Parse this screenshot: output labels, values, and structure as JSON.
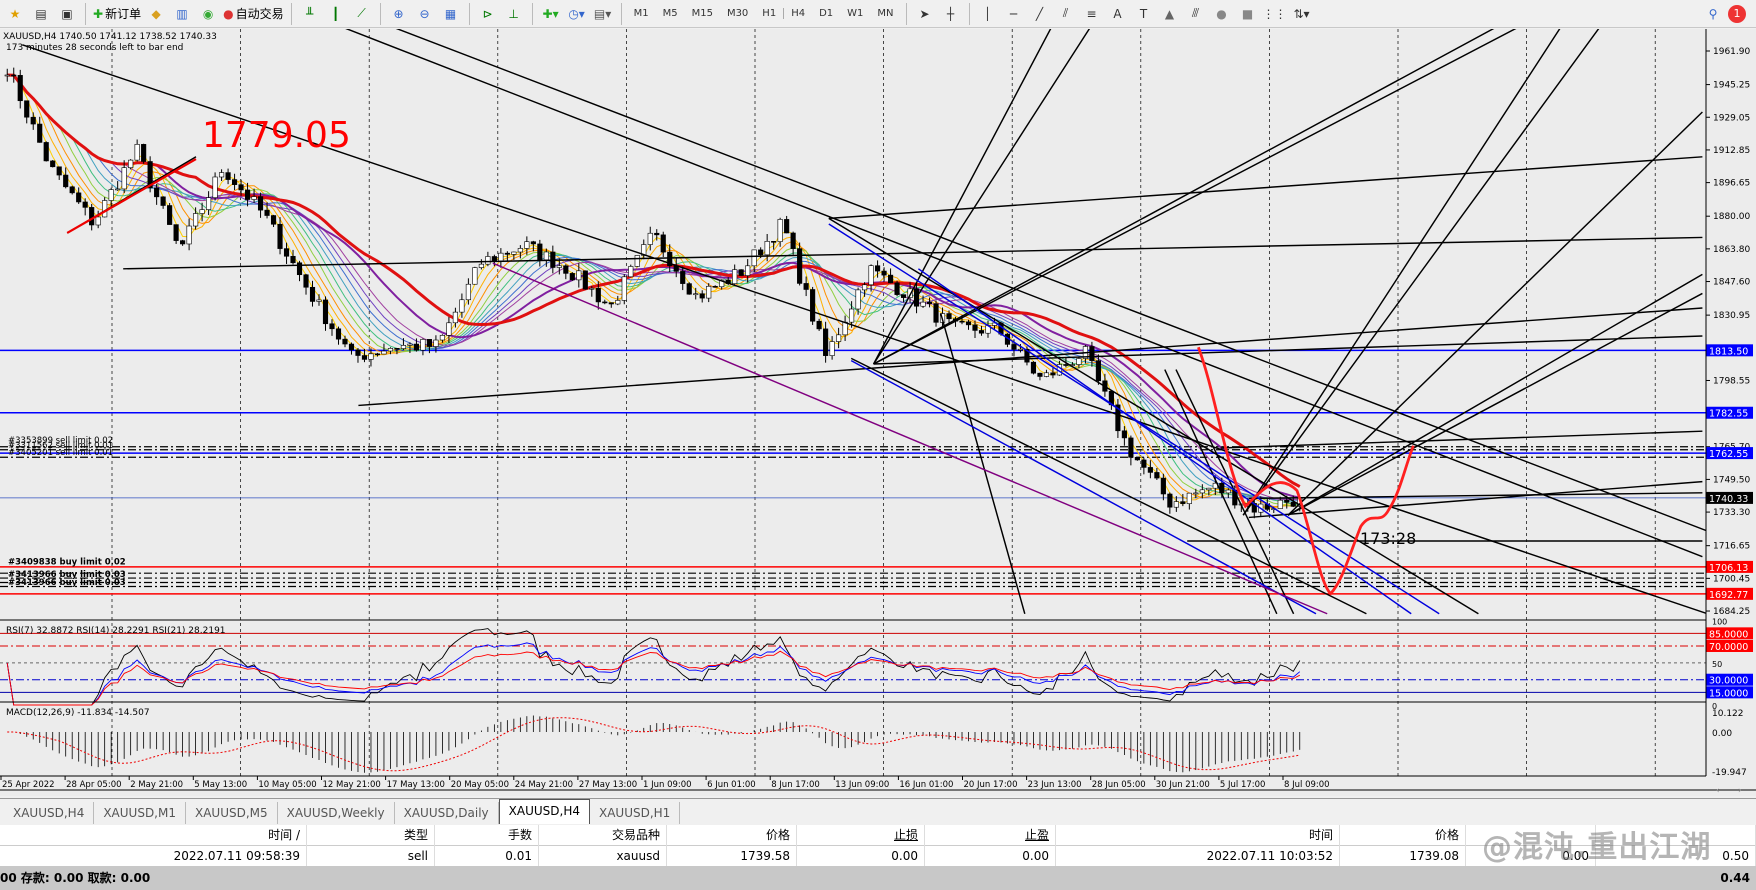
{
  "toolbar": {
    "new_order": "新订单",
    "auto_trading": "自动交易",
    "timeframes": [
      "M1",
      "M5",
      "M15",
      "M30",
      "H1",
      "H4",
      "D1",
      "W1",
      "MN"
    ],
    "notification_count": "1"
  },
  "chart": {
    "symbol_info": "XAUUSD,H4  1740.50 1741.12 1738.52 1740.33",
    "bar_timer": "173 minutes 28 seconds left to bar end",
    "big_label": "1779.05",
    "timer_label": "173:28",
    "price_axis": [
      "1961.90",
      "1945.25",
      "1929.05",
      "1912.85",
      "1896.65",
      "1880.00",
      "1863.80",
      "1847.60",
      "1830.95",
      "1798.55",
      "1765.70",
      "1749.50",
      "1733.30",
      "1716.65",
      "1700.45",
      "1684.25"
    ],
    "price_tags": [
      {
        "value": "1813.50",
        "color": "#0000ff"
      },
      {
        "value": "1782.55",
        "color": "#0000ff"
      },
      {
        "value": "1762.55",
        "color": "#0000ff"
      },
      {
        "value": "1740.33",
        "color": "#000000"
      },
      {
        "value": "1706.13",
        "color": "#ff0000"
      },
      {
        "value": "1692.77",
        "color": "#ff0000"
      }
    ],
    "order_labels": {
      "sell": [
        "#3353899 sell limit 0.02",
        "#3311562 sell limit 0.01",
        "#3405201 sell limit 0.01"
      ],
      "buy": [
        "#3409838 buy limit 0.02",
        "#3413966 buy limit 0.03",
        "#3413966 buy limit 0.03"
      ]
    },
    "closes": [
      1954,
      1904,
      1876.6,
      1913,
      1862.7,
      1904,
      1879.6,
      1843,
      1810,
      1815.7,
      1815.7,
      1857,
      1865.7,
      1854,
      1835,
      1871,
      1840,
      1851.8,
      1876.6,
      1810,
      1854,
      1840,
      1824,
      1824,
      1798.8,
      1812.7,
      1765.6,
      1737.8,
      1746,
      1735,
      1740.33
    ],
    "time_axis": [
      "25 Apr 2022",
      "28 Apr 05:00",
      "2 May 21:00",
      "5 May 13:00",
      "10 May 05:00",
      "12 May 21:00",
      "17 May 13:00",
      "20 May 05:00",
      "24 May 21:00",
      "27 May 13:00",
      "1 Jun 09:00",
      "6 Jun 01:00",
      "8 Jun 17:00",
      "13 Jun 09:00",
      "16 Jun 01:00",
      "20 Jun 17:00",
      "23 Jun 13:00",
      "28 Jun 05:00",
      "30 Jun 21:00",
      "5 Jul 17:00",
      "8 Jul 09:00"
    ]
  },
  "rsi": {
    "header": "RSI(7) 32.8872  RSI(14) 28.2291  RSI(21) 28.2191",
    "levels": [
      {
        "value": "85.0000",
        "color": "#ff0000"
      },
      {
        "value": "70.0000",
        "color": "#ff0000"
      },
      {
        "value": "30.0000",
        "color": "#0000ff"
      },
      {
        "value": "15.0000",
        "color": "#0000ff"
      }
    ],
    "axis": [
      "100",
      "50",
      "0"
    ]
  },
  "macd": {
    "header": "MACD(12,26,9) -11.834 -14.507",
    "axis": [
      "10.122",
      "0.00",
      "-19.947"
    ]
  },
  "tabs": [
    "XAUUSD,H4",
    "XAUUSD,M1",
    "XAUUSD,M5",
    "XAUUSD,Weekly",
    "XAUUSD,Daily",
    "XAUUSD,H4",
    "XAUUSD,H1"
  ],
  "active_tab": 5,
  "trade_table": {
    "headers": [
      "时间 /",
      "类型",
      "手数",
      "交易品种",
      "价格",
      "止损",
      "止盈",
      "时间",
      "价格",
      "",
      ""
    ],
    "row": [
      "2022.07.11 09:58:39",
      "sell",
      "0.01",
      "xauusd",
      "1739.58",
      "0.00",
      "0.00",
      "2022.07.11 10:03:52",
      "1739.08",
      "0.00",
      "0.50"
    ]
  },
  "status": {
    "left": "00  存款: 0.00  取款: 0.00",
    "right": "0.44"
  },
  "watermark": "@混沌.重出江湖"
}
